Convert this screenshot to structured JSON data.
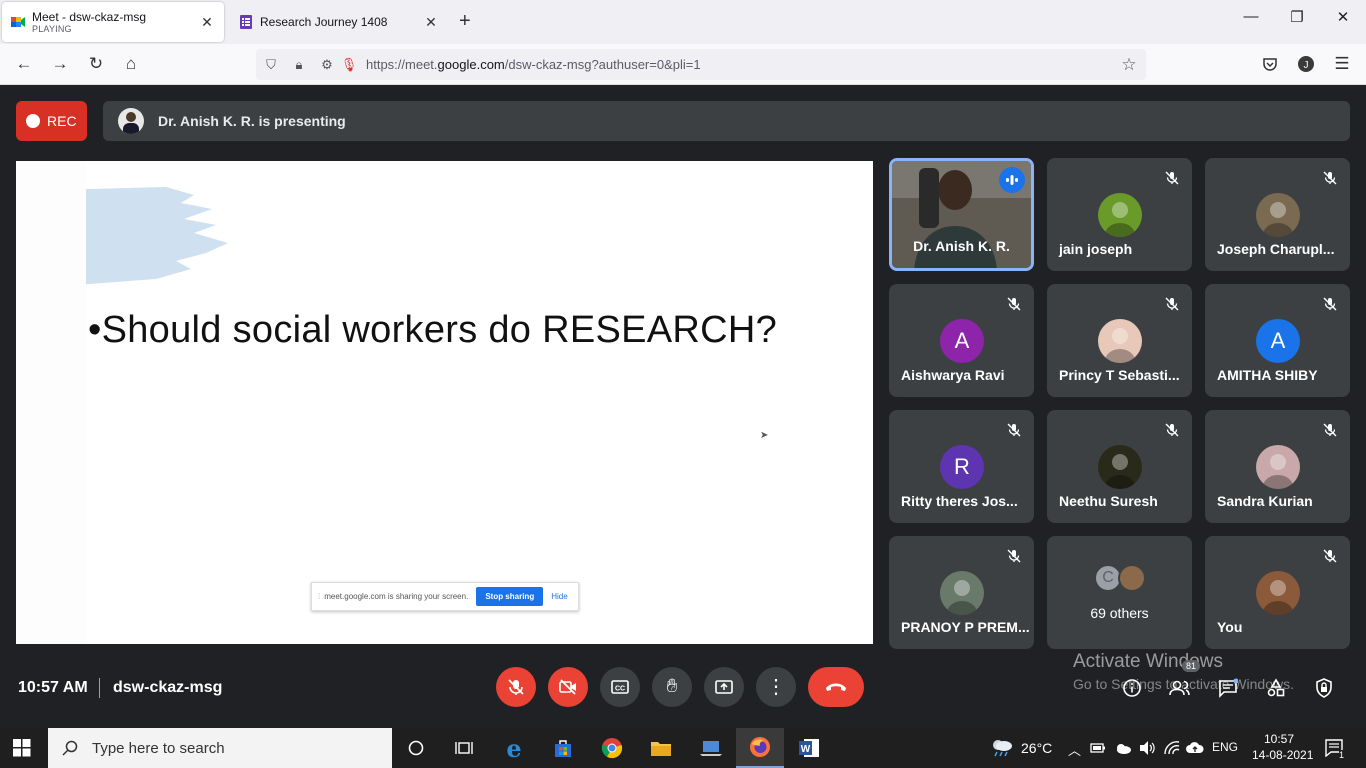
{
  "browser": {
    "tabs": [
      {
        "title": "Meet - dsw-ckaz-msg",
        "subtitle": "PLAYING"
      },
      {
        "title": "Research Journey 1408"
      }
    ],
    "url_prefix": "https://meet.",
    "url_domain": "google.com",
    "url_rest": "/dsw-ckaz-msg?authuser=0&pli=1"
  },
  "meet": {
    "rec_label": "REC",
    "presenting_text": "Dr. Anish K. R. is presenting",
    "slide_text": "•Should social workers do RESEARCH?",
    "share_bar": {
      "message": "meet.google.com is sharing your screen.",
      "stop_label": "Stop sharing",
      "hide_label": "Hide"
    },
    "participants": [
      {
        "name": "Dr. Anish K. R.",
        "type": "video",
        "speaking": true
      },
      {
        "name": "jain joseph",
        "type": "photo",
        "color": "#6a9a2a"
      },
      {
        "name": "Joseph Charupl...",
        "type": "photo",
        "color": "#7a6a52"
      },
      {
        "name": "Aishwarya Ravi",
        "type": "initial",
        "initial": "A",
        "color": "#8e24aa"
      },
      {
        "name": "Princy T Sebasti...",
        "type": "photo",
        "color": "#e8c8b8"
      },
      {
        "name": "AMITHA SHIBY",
        "type": "initial",
        "initial": "A",
        "color": "#1a73e8"
      },
      {
        "name": "Ritty theres Jos...",
        "type": "initial",
        "initial": "R",
        "color": "#5e35b1"
      },
      {
        "name": "Neethu Suresh",
        "type": "photo",
        "color": "#2a2a1a"
      },
      {
        "name": "Sandra Kurian",
        "type": "photo",
        "color": "#c8a8a8"
      },
      {
        "name": "PRANOY P PREM...",
        "type": "photo",
        "color": "#6a7a6a"
      },
      {
        "name": "69 others",
        "type": "others"
      },
      {
        "name": "You",
        "type": "photo",
        "color": "#8a5a3a"
      }
    ],
    "clock": "10:57 AM",
    "meeting_code": "dsw-ckaz-msg",
    "people_count": "81",
    "watermark_title": "Activate Windows",
    "watermark_sub": "Go to Settings to activate Windows."
  },
  "taskbar": {
    "search_placeholder": "Type here to search",
    "temperature": "26°C",
    "language": "ENG",
    "time": "10:57",
    "date": "14-08-2021",
    "notifications": "1"
  }
}
